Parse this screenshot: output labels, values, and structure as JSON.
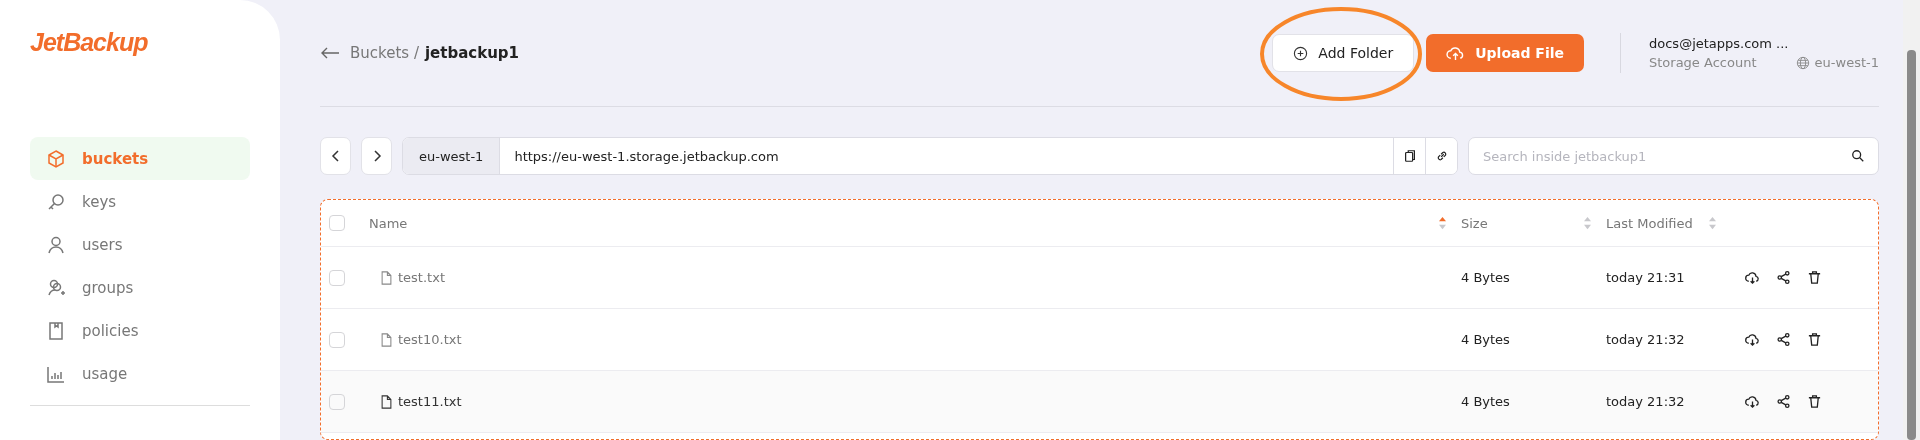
{
  "logo": "JetBackup",
  "sidebar": {
    "items": [
      {
        "label": "buckets",
        "kind": "cube",
        "selected": true
      },
      {
        "label": "keys",
        "kind": "key",
        "selected": false
      },
      {
        "label": "users",
        "kind": "user",
        "selected": false
      },
      {
        "label": "groups",
        "kind": "group",
        "selected": false
      },
      {
        "label": "policies",
        "kind": "book",
        "selected": false
      },
      {
        "label": "usage",
        "kind": "chart",
        "selected": false
      }
    ]
  },
  "breadcrumb": {
    "parent": "Buckets /",
    "current": "jetbackup1"
  },
  "actions": [
    {
      "label": "Add Folder",
      "kind": "secondary",
      "annotated": true
    },
    {
      "label": "Upload File",
      "kind": "primary",
      "annotated": false
    }
  ],
  "account": {
    "email": "docs@jetapps.com ...",
    "role": "Storage Account",
    "region": "eu-west-1"
  },
  "address_bar": {
    "region": "eu-west-1",
    "url": "https://eu-west-1.storage.jetbackup.com"
  },
  "search": {
    "placeholder": "Search inside jetbackup1"
  },
  "table": {
    "all_checked": false,
    "columns": [
      {
        "label": "Name",
        "sorted": true
      },
      {
        "label": "Size",
        "sorted": false
      },
      {
        "label": "Last Modified",
        "sorted": false
      }
    ],
    "rows": [
      {
        "name": "test.txt",
        "size": "4 Bytes",
        "modified": "today 21:31",
        "checked": false,
        "highlighted": false
      },
      {
        "name": "test10.txt",
        "size": "4 Bytes",
        "modified": "today 21:32",
        "checked": false,
        "highlighted": false
      },
      {
        "name": "test11.txt",
        "size": "4 Bytes",
        "modified": "today 21:32",
        "checked": false,
        "highlighted": true
      }
    ]
  }
}
